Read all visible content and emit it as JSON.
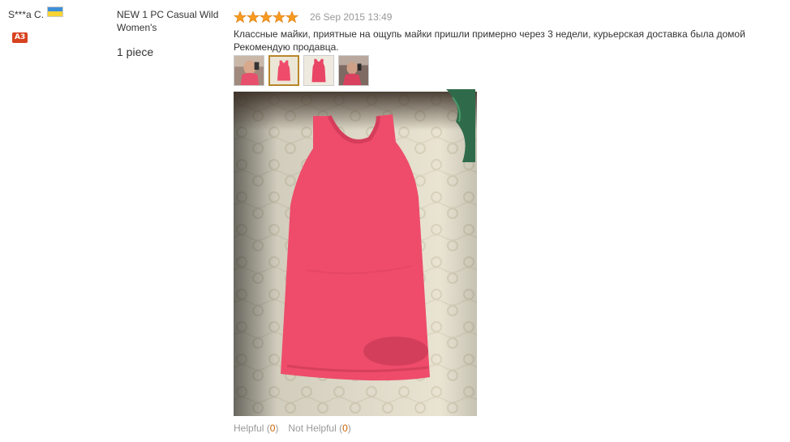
{
  "buyer": {
    "name": "S***a C.",
    "country_flag": "flag-icon",
    "level": "A3"
  },
  "product": {
    "name": "NEW 1 PC Casual Wild Women's",
    "quantity": "1 piece"
  },
  "feedback": {
    "rating": 5,
    "date": "26 Sep 2015 13:49",
    "text": "Классные майки, приятные на ощупь майки пришли примерно через 3 недели, курьерская доставка была домой Рекомендую продавца.",
    "thumbnails": [
      "photo-thumbnail-1",
      "photo-thumbnail-2",
      "photo-thumbnail-3",
      "photo-thumbnail-4"
    ],
    "active_thumbnail": 1
  },
  "helpful": {
    "label": "Helpful",
    "count": "0",
    "not_label": "Not Helpful",
    "not_count": "0"
  },
  "colors": {
    "star": "#f79a1f",
    "badge": "#d8431f",
    "meta_gray": "#999999",
    "tank_top": "#ee4c6a"
  }
}
